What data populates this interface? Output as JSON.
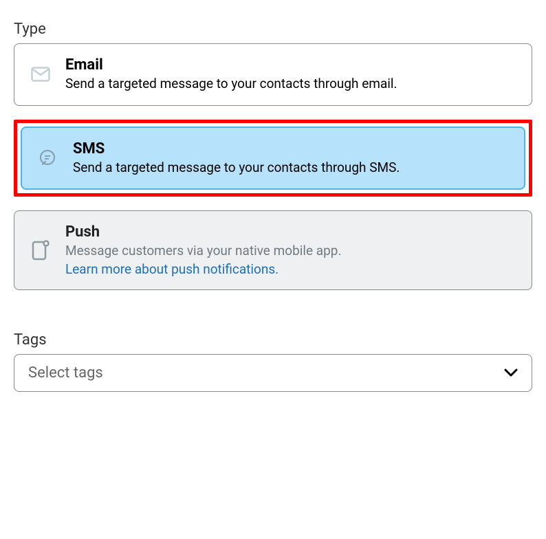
{
  "type_section": {
    "label": "Type",
    "options": [
      {
        "key": "email",
        "title": "Email",
        "desc": "Send a targeted message to your contacts through email.",
        "icon": "email-icon"
      },
      {
        "key": "sms",
        "title": "SMS",
        "desc": "Send a targeted message to your contacts through SMS.",
        "icon": "sms-icon",
        "selected": true,
        "highlighted": true
      },
      {
        "key": "push",
        "title": "Push",
        "desc": "Message customers via your native mobile app.",
        "link_text": "Learn more about push notifications.",
        "icon": "push-icon",
        "disabled": true
      }
    ]
  },
  "tags_section": {
    "label": "Tags",
    "placeholder": "Select tags"
  }
}
